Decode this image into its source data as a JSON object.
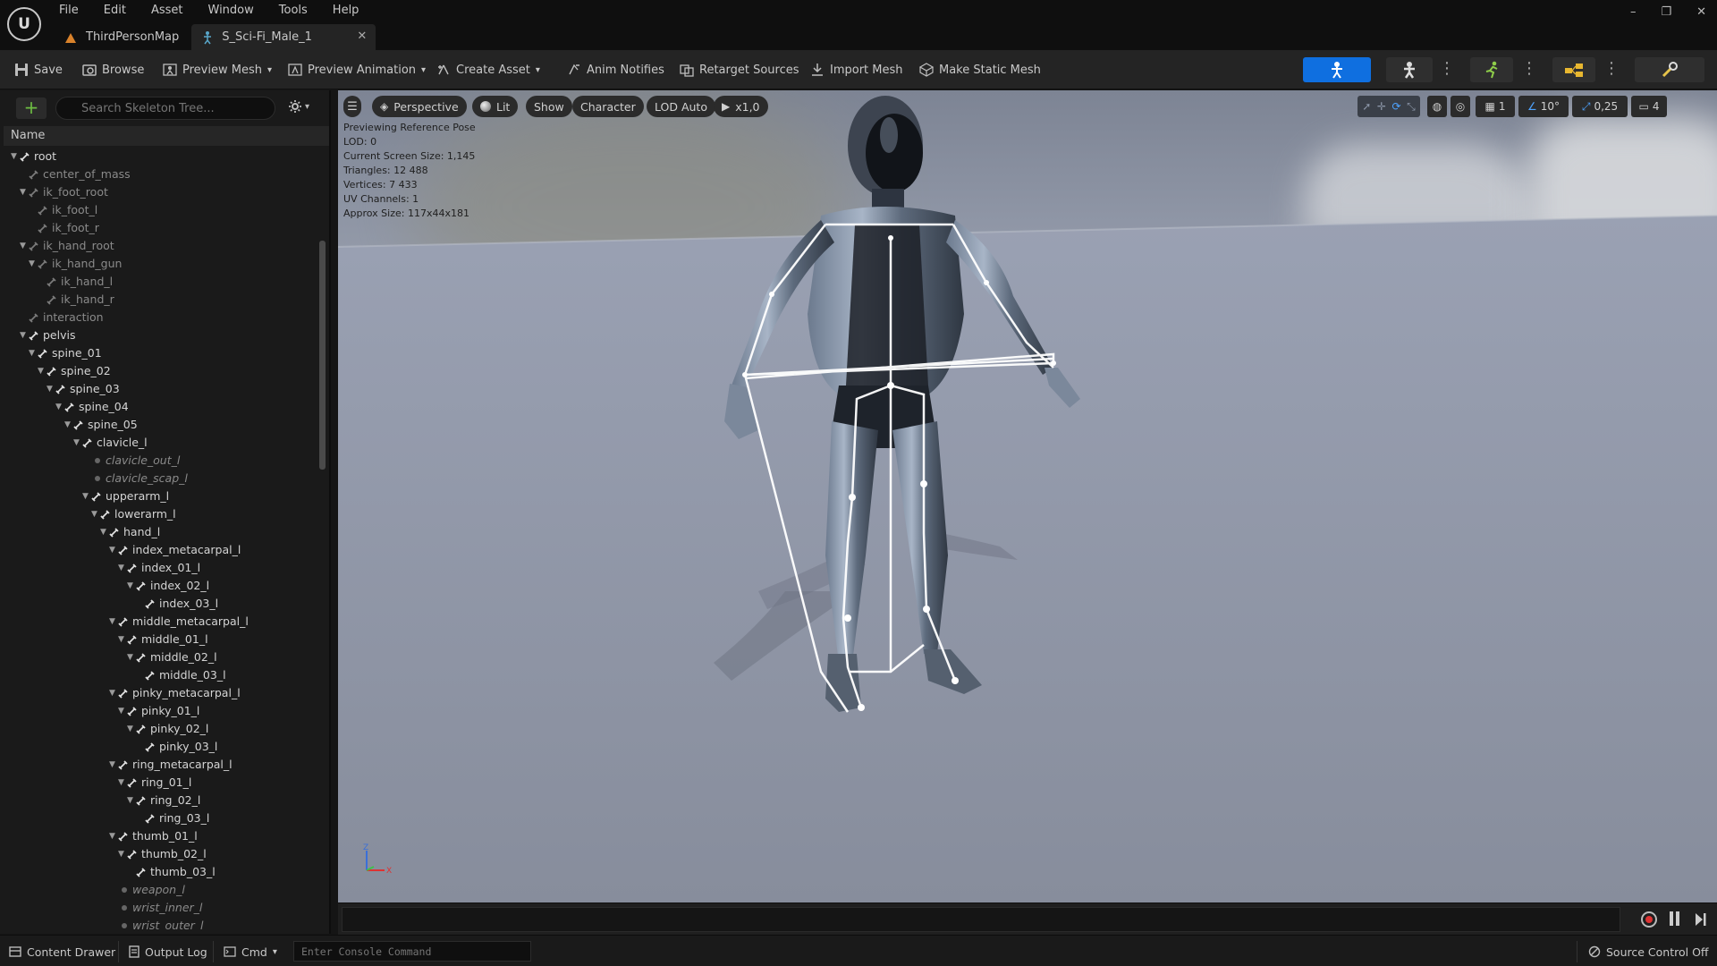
{
  "menu": [
    "File",
    "Edit",
    "Asset",
    "Window",
    "Tools",
    "Help"
  ],
  "tabs": [
    {
      "label": "ThirdPersonMap",
      "active": false
    },
    {
      "label": "S_Sci-Fi_Male_1",
      "active": true
    }
  ],
  "window_controls": {
    "minimize": "–",
    "restore": "❐",
    "close": "✕"
  },
  "toolbar": {
    "save": "Save",
    "browse": "Browse",
    "preview_mesh": "Preview Mesh",
    "preview_animation": "Preview Animation",
    "create_asset": "Create Asset",
    "anim_notifies": "Anim Notifies",
    "retarget_sources": "Retarget Sources",
    "import_mesh": "Import Mesh",
    "make_static_mesh": "Make Static Mesh"
  },
  "skeleton_tree": {
    "search_placeholder": "Search Skeleton Tree...",
    "column_name": "Name",
    "rows": [
      {
        "label": "root",
        "depth": 0,
        "kind": "bone",
        "expanded": true
      },
      {
        "label": "center_of_mass",
        "depth": 1,
        "kind": "virtual"
      },
      {
        "label": "ik_foot_root",
        "depth": 1,
        "kind": "virtual",
        "expanded": true
      },
      {
        "label": "ik_foot_l",
        "depth": 2,
        "kind": "virtual"
      },
      {
        "label": "ik_foot_r",
        "depth": 2,
        "kind": "virtual"
      },
      {
        "label": "ik_hand_root",
        "depth": 1,
        "kind": "virtual",
        "expanded": true
      },
      {
        "label": "ik_hand_gun",
        "depth": 2,
        "kind": "virtual",
        "expanded": true
      },
      {
        "label": "ik_hand_l",
        "depth": 3,
        "kind": "virtual"
      },
      {
        "label": "ik_hand_r",
        "depth": 3,
        "kind": "virtual"
      },
      {
        "label": "interaction",
        "depth": 1,
        "kind": "virtual"
      },
      {
        "label": "pelvis",
        "depth": 1,
        "kind": "bone",
        "expanded": true
      },
      {
        "label": "spine_01",
        "depth": 2,
        "kind": "bone",
        "expanded": true
      },
      {
        "label": "spine_02",
        "depth": 3,
        "kind": "bone",
        "expanded": true
      },
      {
        "label": "spine_03",
        "depth": 4,
        "kind": "bone",
        "expanded": true
      },
      {
        "label": "spine_04",
        "depth": 5,
        "kind": "bone",
        "expanded": true
      },
      {
        "label": "spine_05",
        "depth": 6,
        "kind": "bone",
        "expanded": true
      },
      {
        "label": "clavicle_l",
        "depth": 7,
        "kind": "bone",
        "expanded": true
      },
      {
        "label": "clavicle_out_l",
        "depth": 8,
        "kind": "socket"
      },
      {
        "label": "clavicle_scap_l",
        "depth": 8,
        "kind": "socket"
      },
      {
        "label": "upperarm_l",
        "depth": 8,
        "kind": "bone",
        "expanded": true
      },
      {
        "label": "lowerarm_l",
        "depth": 9,
        "kind": "bone",
        "expanded": true
      },
      {
        "label": "hand_l",
        "depth": 10,
        "kind": "bone",
        "expanded": true
      },
      {
        "label": "index_metacarpal_l",
        "depth": 11,
        "kind": "bone",
        "expanded": true
      },
      {
        "label": "index_01_l",
        "depth": 12,
        "kind": "bone",
        "expanded": true
      },
      {
        "label": "index_02_l",
        "depth": 13,
        "kind": "bone",
        "expanded": true
      },
      {
        "label": "index_03_l",
        "depth": 14,
        "kind": "bone"
      },
      {
        "label": "middle_metacarpal_l",
        "depth": 11,
        "kind": "bone",
        "expanded": true
      },
      {
        "label": "middle_01_l",
        "depth": 12,
        "kind": "bone",
        "expanded": true
      },
      {
        "label": "middle_02_l",
        "depth": 13,
        "kind": "bone",
        "expanded": true
      },
      {
        "label": "middle_03_l",
        "depth": 14,
        "kind": "bone"
      },
      {
        "label": "pinky_metacarpal_l",
        "depth": 11,
        "kind": "bone",
        "expanded": true
      },
      {
        "label": "pinky_01_l",
        "depth": 12,
        "kind": "bone",
        "expanded": true
      },
      {
        "label": "pinky_02_l",
        "depth": 13,
        "kind": "bone",
        "expanded": true
      },
      {
        "label": "pinky_03_l",
        "depth": 14,
        "kind": "bone"
      },
      {
        "label": "ring_metacarpal_l",
        "depth": 11,
        "kind": "bone",
        "expanded": true
      },
      {
        "label": "ring_01_l",
        "depth": 12,
        "kind": "bone",
        "expanded": true
      },
      {
        "label": "ring_02_l",
        "depth": 13,
        "kind": "bone",
        "expanded": true
      },
      {
        "label": "ring_03_l",
        "depth": 14,
        "kind": "bone"
      },
      {
        "label": "thumb_01_l",
        "depth": 11,
        "kind": "bone",
        "expanded": true
      },
      {
        "label": "thumb_02_l",
        "depth": 12,
        "kind": "bone",
        "expanded": true
      },
      {
        "label": "thumb_03_l",
        "depth": 13,
        "kind": "bone"
      },
      {
        "label": "weapon_l",
        "depth": 11,
        "kind": "socket"
      },
      {
        "label": "wrist_inner_l",
        "depth": 11,
        "kind": "socket"
      },
      {
        "label": "wrist_outer_l",
        "depth": 11,
        "kind": "socket"
      }
    ]
  },
  "viewport": {
    "perspective": "Perspective",
    "lit": "Lit",
    "show": "Show",
    "character": "Character",
    "lod": "LOD Auto",
    "play_rate": "x1,0",
    "grid_value": "1",
    "rotation_snap": "10°",
    "scale_snap": "0,25",
    "camera_speed": "4",
    "axis_z": "Z",
    "axis_x": "X",
    "info": [
      "Previewing Reference Pose",
      "LOD: 0",
      "Current Screen Size: 1,145",
      "Triangles: 12 488",
      "Vertices: 7 433",
      "UV Channels: 1",
      "Approx Size: 117x44x181"
    ]
  },
  "statusbar": {
    "content_drawer": "Content Drawer",
    "output_log": "Output Log",
    "cmd": "Cmd",
    "console_placeholder": "Enter Console Command",
    "source_control": "Source Control Off"
  },
  "colors": {
    "accent_blue": "#0f6fe0",
    "add_green": "#6dbd43"
  }
}
